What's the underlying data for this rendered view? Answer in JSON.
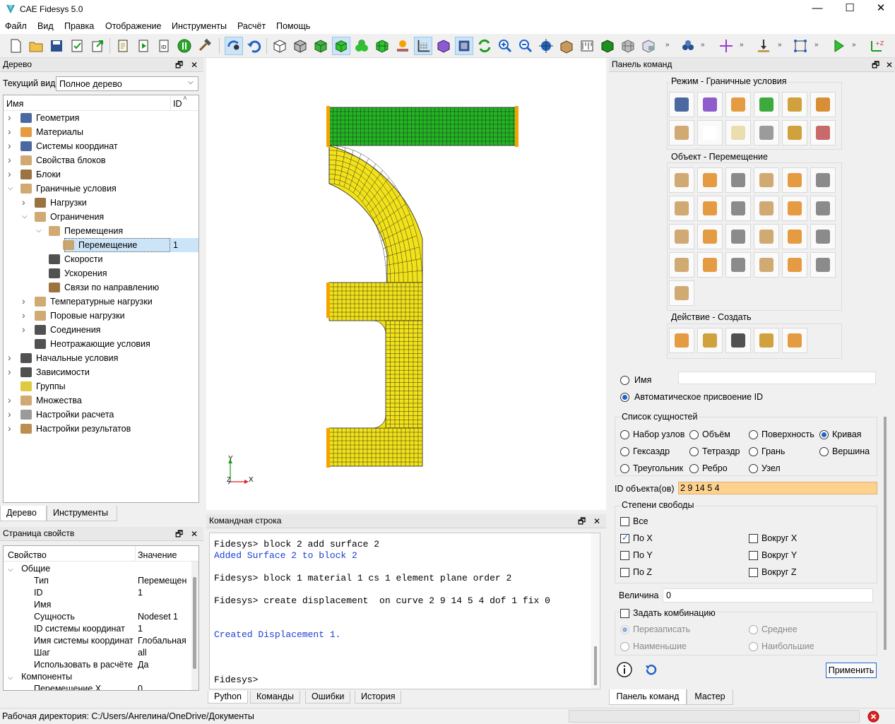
{
  "window": {
    "title": "CAE Fidesys 5.0",
    "minimize": "—",
    "maximize": "☐",
    "close": "✕"
  },
  "menu": [
    "Файл",
    "Вид",
    "Правка",
    "Отображение",
    "Инструменты",
    "Расчёт",
    "Помощь"
  ],
  "tree_panel": {
    "title": "Дерево",
    "current_view_label": "Текущий вид",
    "current_view_value": "Полное дерево",
    "col_name": "Имя",
    "col_id": "ID",
    "items": [
      {
        "label": "Геометрия",
        "level": 0,
        "expanded": false
      },
      {
        "label": "Материалы",
        "level": 0,
        "expanded": false
      },
      {
        "label": "Системы координат",
        "level": 0,
        "expanded": false
      },
      {
        "label": "Свойства блоков",
        "level": 0,
        "expanded": false
      },
      {
        "label": "Блоки",
        "level": 0,
        "expanded": false
      },
      {
        "label": "Граничные условия",
        "level": 0,
        "expanded": true
      },
      {
        "label": "Нагрузки",
        "level": 1,
        "expanded": false
      },
      {
        "label": "Ограничения",
        "level": 1,
        "expanded": true
      },
      {
        "label": "Перемещения",
        "level": 2,
        "expanded": true
      },
      {
        "label": "Перемещение",
        "level": 3,
        "id": "1",
        "selected": true
      },
      {
        "label": "Скорости",
        "level": 2
      },
      {
        "label": "Ускорения",
        "level": 2
      },
      {
        "label": "Связи по направлению",
        "level": 2
      },
      {
        "label": "Температурные нагрузки",
        "level": 1,
        "expanded": false
      },
      {
        "label": "Поровые нагрузки",
        "level": 1,
        "expanded": false
      },
      {
        "label": "Соединения",
        "level": 1,
        "expanded": false
      },
      {
        "label": "Неотражающие условия",
        "level": 1
      },
      {
        "label": "Начальные условия",
        "level": 0,
        "expanded": false
      },
      {
        "label": "Зависимости",
        "level": 0,
        "expanded": false
      },
      {
        "label": "Группы",
        "level": 0
      },
      {
        "label": "Множества",
        "level": 0,
        "expanded": false
      },
      {
        "label": "Настройки расчета",
        "level": 0,
        "expanded": false
      },
      {
        "label": "Настройки результатов",
        "level": 0,
        "expanded": false
      }
    ],
    "tabs": [
      "Дерево",
      "Инструменты"
    ]
  },
  "props_panel": {
    "title": "Страница свойств",
    "col_prop": "Свойство",
    "col_value": "Значение",
    "group_general": "Общие",
    "rows": [
      {
        "name": "Тип",
        "value": "Перемещен"
      },
      {
        "name": "ID",
        "value": "1"
      },
      {
        "name": "Имя",
        "value": ""
      },
      {
        "name": "Сущность",
        "value": "Nodeset 1"
      },
      {
        "name": "ID системы координат",
        "value": "1"
      },
      {
        "name": "Имя системы координат",
        "value": "Глобальная"
      },
      {
        "name": "Шаг",
        "value": "all"
      },
      {
        "name": "Использовать в расчёте",
        "value": "Да"
      }
    ],
    "group_components": "Компоненты",
    "partial_row": {
      "name": "Перемещение X",
      "value": "0"
    }
  },
  "viewport": {
    "axis_x": "X",
    "axis_y": "Y",
    "axis_z": "Z"
  },
  "command_panel": {
    "title": "Командная строка",
    "lines": [
      {
        "text": "Fidesys> block 2 add surface 2",
        "style": "normal"
      },
      {
        "text": "Added Surface 2 to block 2",
        "style": "blue"
      },
      {
        "text": "",
        "style": "normal"
      },
      {
        "text": "Fidesys> block 1 material 1 cs 1 element plane order 2",
        "style": "normal"
      },
      {
        "text": "",
        "style": "normal"
      },
      {
        "text": "Fidesys> create displacement  on curve 2 9 14 5 4 dof 1 fix 0",
        "style": "normal"
      },
      {
        "text": "",
        "style": "normal"
      },
      {
        "text": "",
        "style": "normal"
      },
      {
        "text": "Created Displacement 1.",
        "style": "blue"
      },
      {
        "text": "",
        "style": "normal"
      },
      {
        "text": "",
        "style": "normal"
      },
      {
        "text": "",
        "style": "normal"
      },
      {
        "text": "Fidesys> ",
        "style": "normal"
      }
    ],
    "tabs": [
      "Python",
      "Команды",
      "Ошибки",
      "История"
    ]
  },
  "right_panel": {
    "title": "Панель команд",
    "mode_title": "Режим - Граничные условия",
    "object_title": "Объект - Перемещение",
    "action_title": "Действие - Создать",
    "name_label": "Имя",
    "auto_id_label": "Автоматическое присвоение ID",
    "entity_list_title": "Список сущностей",
    "entities": [
      "Набор узлов",
      "Объём",
      "Поверхность",
      "Кривая",
      "Гексаэдр",
      "Тетраэдр",
      "Грань",
      "Вершина",
      "Треугольник",
      "Ребро",
      "Узел"
    ],
    "entity_selected": "Кривая",
    "object_ids_label": "ID объекта(ов)",
    "object_ids_value": "2 9 14 5 4",
    "dof_title": "Степени свободы",
    "dof_all": "Все",
    "dof_items": [
      "По X",
      "Вокруг X",
      "По Y",
      "Вокруг Y",
      "По Z",
      "Вокруг Z"
    ],
    "dof_checked": "По X",
    "magnitude_label": "Величина",
    "magnitude_value": "0",
    "combination_label": "Задать комбинацию",
    "combo_options": [
      "Перезаписать",
      "Среднее",
      "Наименьшие",
      "Наибольшие"
    ],
    "apply_label": "Применить",
    "tabs": [
      "Панель команд",
      "Мастер"
    ]
  },
  "statusbar": {
    "workdir": "Рабочая директория: C:/Users/Ангелина/OneDrive/Документы"
  },
  "colors": {
    "mesh_green": "#22b522",
    "mesh_yellow": "#f2e219",
    "bc_orange": "#f5a300",
    "ids_bg": "#fdd28f",
    "selection": "#cce4f7"
  }
}
